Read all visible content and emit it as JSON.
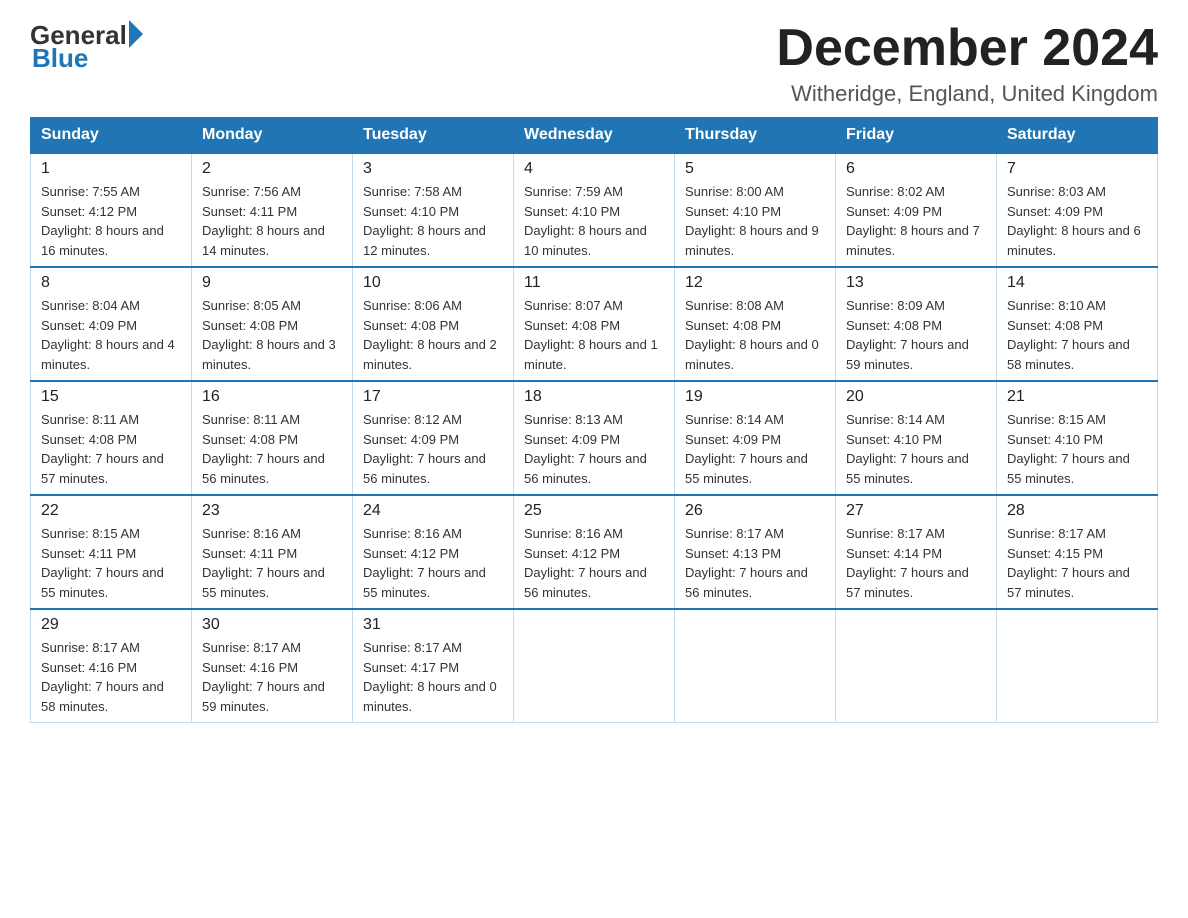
{
  "header": {
    "logo_general": "General",
    "logo_blue": "Blue",
    "month_title": "December 2024",
    "location": "Witheridge, England, United Kingdom"
  },
  "weekdays": [
    "Sunday",
    "Monday",
    "Tuesday",
    "Wednesday",
    "Thursday",
    "Friday",
    "Saturday"
  ],
  "weeks": [
    [
      {
        "day": "1",
        "sunrise": "7:55 AM",
        "sunset": "4:12 PM",
        "daylight": "8 hours and 16 minutes."
      },
      {
        "day": "2",
        "sunrise": "7:56 AM",
        "sunset": "4:11 PM",
        "daylight": "8 hours and 14 minutes."
      },
      {
        "day": "3",
        "sunrise": "7:58 AM",
        "sunset": "4:10 PM",
        "daylight": "8 hours and 12 minutes."
      },
      {
        "day": "4",
        "sunrise": "7:59 AM",
        "sunset": "4:10 PM",
        "daylight": "8 hours and 10 minutes."
      },
      {
        "day": "5",
        "sunrise": "8:00 AM",
        "sunset": "4:10 PM",
        "daylight": "8 hours and 9 minutes."
      },
      {
        "day": "6",
        "sunrise": "8:02 AM",
        "sunset": "4:09 PM",
        "daylight": "8 hours and 7 minutes."
      },
      {
        "day": "7",
        "sunrise": "8:03 AM",
        "sunset": "4:09 PM",
        "daylight": "8 hours and 6 minutes."
      }
    ],
    [
      {
        "day": "8",
        "sunrise": "8:04 AM",
        "sunset": "4:09 PM",
        "daylight": "8 hours and 4 minutes."
      },
      {
        "day": "9",
        "sunrise": "8:05 AM",
        "sunset": "4:08 PM",
        "daylight": "8 hours and 3 minutes."
      },
      {
        "day": "10",
        "sunrise": "8:06 AM",
        "sunset": "4:08 PM",
        "daylight": "8 hours and 2 minutes."
      },
      {
        "day": "11",
        "sunrise": "8:07 AM",
        "sunset": "4:08 PM",
        "daylight": "8 hours and 1 minute."
      },
      {
        "day": "12",
        "sunrise": "8:08 AM",
        "sunset": "4:08 PM",
        "daylight": "8 hours and 0 minutes."
      },
      {
        "day": "13",
        "sunrise": "8:09 AM",
        "sunset": "4:08 PM",
        "daylight": "7 hours and 59 minutes."
      },
      {
        "day": "14",
        "sunrise": "8:10 AM",
        "sunset": "4:08 PM",
        "daylight": "7 hours and 58 minutes."
      }
    ],
    [
      {
        "day": "15",
        "sunrise": "8:11 AM",
        "sunset": "4:08 PM",
        "daylight": "7 hours and 57 minutes."
      },
      {
        "day": "16",
        "sunrise": "8:11 AM",
        "sunset": "4:08 PM",
        "daylight": "7 hours and 56 minutes."
      },
      {
        "day": "17",
        "sunrise": "8:12 AM",
        "sunset": "4:09 PM",
        "daylight": "7 hours and 56 minutes."
      },
      {
        "day": "18",
        "sunrise": "8:13 AM",
        "sunset": "4:09 PM",
        "daylight": "7 hours and 56 minutes."
      },
      {
        "day": "19",
        "sunrise": "8:14 AM",
        "sunset": "4:09 PM",
        "daylight": "7 hours and 55 minutes."
      },
      {
        "day": "20",
        "sunrise": "8:14 AM",
        "sunset": "4:10 PM",
        "daylight": "7 hours and 55 minutes."
      },
      {
        "day": "21",
        "sunrise": "8:15 AM",
        "sunset": "4:10 PM",
        "daylight": "7 hours and 55 minutes."
      }
    ],
    [
      {
        "day": "22",
        "sunrise": "8:15 AM",
        "sunset": "4:11 PM",
        "daylight": "7 hours and 55 minutes."
      },
      {
        "day": "23",
        "sunrise": "8:16 AM",
        "sunset": "4:11 PM",
        "daylight": "7 hours and 55 minutes."
      },
      {
        "day": "24",
        "sunrise": "8:16 AM",
        "sunset": "4:12 PM",
        "daylight": "7 hours and 55 minutes."
      },
      {
        "day": "25",
        "sunrise": "8:16 AM",
        "sunset": "4:12 PM",
        "daylight": "7 hours and 56 minutes."
      },
      {
        "day": "26",
        "sunrise": "8:17 AM",
        "sunset": "4:13 PM",
        "daylight": "7 hours and 56 minutes."
      },
      {
        "day": "27",
        "sunrise": "8:17 AM",
        "sunset": "4:14 PM",
        "daylight": "7 hours and 57 minutes."
      },
      {
        "day": "28",
        "sunrise": "8:17 AM",
        "sunset": "4:15 PM",
        "daylight": "7 hours and 57 minutes."
      }
    ],
    [
      {
        "day": "29",
        "sunrise": "8:17 AM",
        "sunset": "4:16 PM",
        "daylight": "7 hours and 58 minutes."
      },
      {
        "day": "30",
        "sunrise": "8:17 AM",
        "sunset": "4:16 PM",
        "daylight": "7 hours and 59 minutes."
      },
      {
        "day": "31",
        "sunrise": "8:17 AM",
        "sunset": "4:17 PM",
        "daylight": "8 hours and 0 minutes."
      },
      null,
      null,
      null,
      null
    ]
  ],
  "labels": {
    "sunrise": "Sunrise:",
    "sunset": "Sunset:",
    "daylight": "Daylight:"
  }
}
